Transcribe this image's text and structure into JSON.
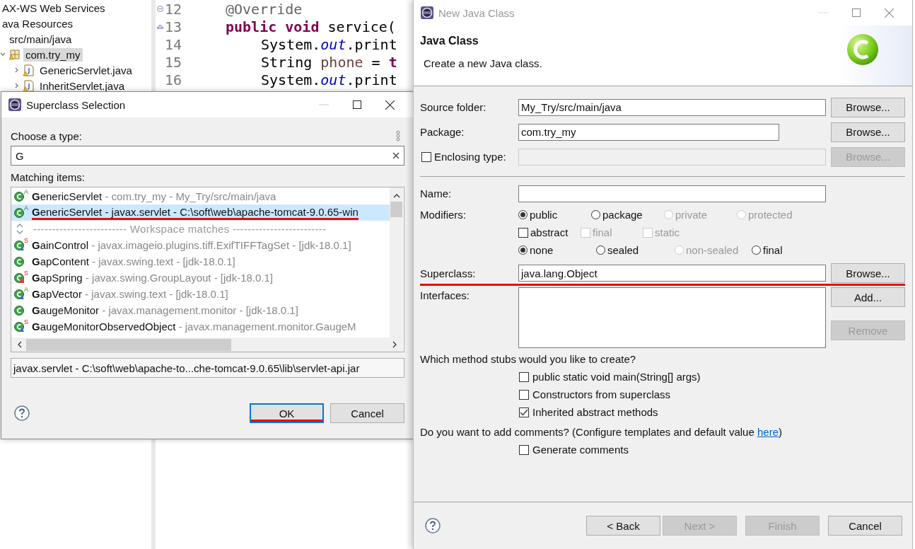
{
  "ide": {
    "tree": [
      {
        "label": "AX-WS Web Services",
        "selected": false
      },
      {
        "label": "ava Resources",
        "selected": false,
        "children": [
          {
            "label": "src/main/java",
            "selected": false,
            "children": [
              {
                "label": "com.try_my",
                "selected": true,
                "kind": "package",
                "expanded": true,
                "children": [
                  {
                    "label": "GenericServlet.java",
                    "selected": false,
                    "kind": "file",
                    "expanded": false
                  },
                  {
                    "label": "InheritServlet.java",
                    "selected": false,
                    "kind": "file",
                    "expanded": false
                  }
                ]
              }
            ]
          }
        ]
      }
    ],
    "editor": {
      "lines": [
        {
          "number": "12",
          "kind": "annotation",
          "tokens": [
            {
              "text": "@Override",
              "kind": "annotation"
            }
          ]
        },
        {
          "number": "13",
          "kind": "signature",
          "tokens": [
            {
              "text": "public void",
              "kind": "keyword"
            },
            {
              "text": " service(",
              "kind": "plain"
            }
          ]
        },
        {
          "number": "14",
          "kind": "statement",
          "tokens": [
            {
              "text": "System.",
              "kind": "plain"
            },
            {
              "text": "out",
              "kind": "field"
            },
            {
              "text": ".print",
              "kind": "plain"
            }
          ]
        },
        {
          "number": "15",
          "kind": "statement",
          "tokens": [
            {
              "text": "String ",
              "kind": "plain"
            },
            {
              "text": "phone",
              "kind": "local"
            },
            {
              "text": " = ",
              "kind": "plain"
            },
            {
              "text": "t",
              "kind": "keyword"
            }
          ]
        },
        {
          "number": "16",
          "kind": "statement",
          "tokens": [
            {
              "text": "System.",
              "kind": "plain"
            },
            {
              "text": "out",
              "kind": "field"
            },
            {
              "text": ".print",
              "kind": "plain"
            }
          ]
        }
      ]
    }
  },
  "superclass_dialog": {
    "title": "Superclass Selection",
    "prompt": "Choose a type:",
    "search": {
      "value": "G"
    },
    "list_label": "Matching items:",
    "items": [
      {
        "kind": "class",
        "name": "**G**enericServlet",
        "detail": "- com.try_my - My_Try/src/main/java",
        "badge": "A",
        "selected": false,
        "underlined": false
      },
      {
        "kind": "class",
        "name": "**G**enericServlet",
        "detail": "- javax.servlet - C:\\soft\\web\\apache-tomcat-9.0.65-win",
        "badge": "A",
        "selected": true,
        "underlined": true
      },
      {
        "kind": "separator",
        "label": "------------------------- Workspace matches -------------------------"
      },
      {
        "kind": "package-class",
        "name": "**G**ainControl",
        "detail": "- javax.imageio.plugins.tiff.ExifTIFFTagSet - [jdk-18.0.1]",
        "badge": "S",
        "selected": false,
        "underlined": false
      },
      {
        "kind": "class",
        "name": "**G**apContent",
        "detail": "- javax.swing.text - [jdk-18.0.1]",
        "selected": false,
        "underlined": false
      },
      {
        "kind": "private-class",
        "name": "**G**apSpring",
        "detail": "- javax.swing.GroupLayout - [jdk-18.0.1]",
        "badge": "S",
        "selected": false,
        "underlined": false
      },
      {
        "kind": "package-class",
        "name": "**G**apVector",
        "detail": "- javax.swing.text - [jdk-18.0.1]",
        "badge": "A",
        "selected": false,
        "underlined": false
      },
      {
        "kind": "class",
        "name": "**G**augeMonitor",
        "detail": "- javax.management.monitor - [jdk-18.0.1]",
        "selected": false,
        "underlined": false
      },
      {
        "kind": "package-class",
        "name": "**G**augeMonitorObservedObject",
        "detail": "- javax.management.monitor.GaugeM",
        "badge": "S",
        "selected": false,
        "underlined": false
      }
    ],
    "location": "javax.servlet - C:\\soft\\web\\apache-to...che-tomcat-9.0.65\\lib\\servlet-api.jar",
    "buttons": [
      {
        "label": "OK",
        "default": true,
        "underlined": true
      },
      {
        "label": "Cancel",
        "default": false,
        "underlined": false
      }
    ]
  },
  "new_class_dialog": {
    "title": "New Java Class",
    "heading": "Java Class",
    "description": "Create a new Java class.",
    "source_folder": {
      "label": "Source folder:",
      "value": "My_Try/src/main/java",
      "button": {
        "label": "Browse...",
        "disabled": false
      }
    },
    "package": {
      "label": "Package:",
      "value": "com.try_my",
      "button": {
        "label": "Browse...",
        "disabled": false
      }
    },
    "enclosing_type": {
      "label": "Enclosing type:",
      "checked": false,
      "button": {
        "label": "Browse...",
        "disabled": true
      }
    },
    "name": {
      "label": "Name:"
    },
    "modifiers": {
      "label": "Modifiers:",
      "groups": [
        [
          {
            "kind": "radio",
            "label": "public",
            "selected": true,
            "disabled": false
          },
          {
            "kind": "radio",
            "label": "package",
            "selected": false,
            "disabled": false
          },
          {
            "kind": "radio",
            "label": "private",
            "selected": false,
            "disabled": true
          },
          {
            "kind": "radio",
            "label": "protected",
            "selected": false,
            "disabled": true
          }
        ],
        [
          {
            "kind": "checkbox",
            "label": "abstract",
            "checked": false,
            "disabled": false
          },
          {
            "kind": "checkbox",
            "label": "final",
            "checked": false,
            "disabled": true
          },
          {
            "kind": "checkbox",
            "label": "static",
            "checked": false,
            "disabled": true
          }
        ],
        [
          {
            "kind": "radio",
            "label": "none",
            "selected": true,
            "disabled": false
          },
          {
            "kind": "radio",
            "label": "sealed",
            "selected": false,
            "disabled": false
          },
          {
            "kind": "radio",
            "label": "non-sealed",
            "selected": false,
            "disabled": true
          },
          {
            "kind": "radio",
            "label": "final",
            "selected": false,
            "disabled": false
          }
        ]
      ]
    },
    "superclass": {
      "label": "Superclass:",
      "value": "java.lang.Object",
      "underlined": true,
      "button": {
        "label": "Browse...",
        "disabled": false
      }
    },
    "interfaces": {
      "label": "Interfaces:",
      "buttons": [
        {
          "label": "Add...",
          "disabled": false
        },
        {
          "label": "Remove",
          "disabled": true
        }
      ]
    },
    "stubs": {
      "question": "Which method stubs would you like to create?",
      "options": [
        {
          "label": "public static void main(String[] args)",
          "checked": false
        },
        {
          "label": "Constructors from superclass",
          "checked": false
        },
        {
          "label": "Inherited abstract methods",
          "checked": true
        }
      ]
    },
    "comments": {
      "before": "Do you want to add comments? (Configure templates and default value ",
      "link": "here",
      "after": ")",
      "option": {
        "label": "Generate comments",
        "checked": false
      }
    },
    "buttons": [
      {
        "label": "< Back",
        "disabled": false
      },
      {
        "label": "Next >",
        "disabled": true
      },
      {
        "label": "Finish",
        "disabled": true
      },
      {
        "label": "Cancel",
        "disabled": false
      }
    ]
  }
}
